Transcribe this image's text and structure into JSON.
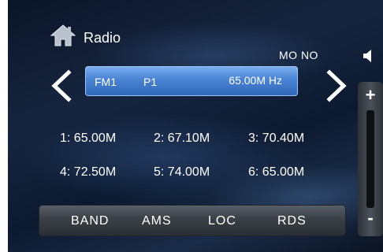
{
  "header": {
    "title": "Radio",
    "home_icon": "home-icon",
    "mode": "MO NO",
    "speaker_icon": "speaker-icon"
  },
  "tuner": {
    "prev_icon": "chevron-left-icon",
    "next_icon": "chevron-right-icon",
    "band": "FM1",
    "preset": "P1",
    "frequency": "65.00M Hz"
  },
  "presets": [
    {
      "label": "1: 65.00M"
    },
    {
      "label": "2: 67.10M"
    },
    {
      "label": "3: 70.40M"
    },
    {
      "label": "4: 72.50M"
    },
    {
      "label": "5: 74.00M"
    },
    {
      "label": "6: 65.00M"
    }
  ],
  "bottom_bar": {
    "band": "BAND",
    "ams": "AMS",
    "loc": "LOC",
    "rds": "RDS"
  },
  "volume": {
    "plus": "+",
    "minus": "-"
  },
  "colors": {
    "display_accent": "#4c86d6",
    "background": "#0c1a30"
  }
}
